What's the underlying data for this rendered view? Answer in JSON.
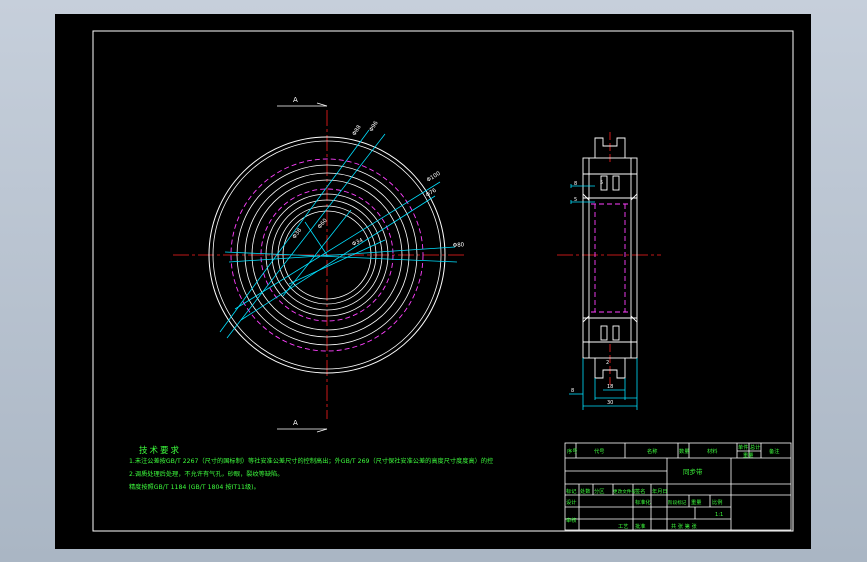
{
  "drawing": {
    "section_label": "A",
    "front_view": {
      "dimensions": [
        "Φ88",
        "Φ96",
        "Φ100",
        "Φ76",
        "Φ80",
        "Φ60",
        "Φ38",
        "Φ34"
      ]
    },
    "side_view": {
      "dimensions": [
        "8",
        "5",
        "5",
        "18",
        "2",
        "30",
        "8"
      ]
    }
  },
  "tech_requirements": {
    "title": "技术要求",
    "lines": [
      "1.未注公差按GB/T 2267（尺寸的国标制）等社安准公差尺寸的控制高出；外GB/T 269（尺寸保社安准公差的高度尺寸度度高）的控",
      "2.调质处理后处理，不允许有气孔，砂眼，裂纹等缺陷。",
      "  精度按照GB/T 1184 (GB/T 1804 按IT11级)。"
    ]
  },
  "title_block": {
    "part_name": "同步带",
    "headers": [
      "序号",
      "代号",
      "名称",
      "数量",
      "材料",
      "单件",
      "总计",
      "备注"
    ],
    "weight_label": "重量",
    "row_labels": [
      "标记",
      "处数",
      "分区",
      "更改文件号",
      "签名",
      "年月日"
    ],
    "sign_labels": [
      "设计",
      "标准化",
      "阶段标记",
      "重量",
      "比例"
    ],
    "check_labels": [
      "审核",
      "工艺",
      "批准"
    ],
    "sheet_info": "共 张 第 张",
    "scale": "1:1"
  },
  "colors": {
    "background": "#000000",
    "outline": "#ffffff",
    "centerline": "#ff2020",
    "dimension": "#00e0ff",
    "hidden": "#ff40ff",
    "text": "#3dfc3d",
    "table": "#ffffff"
  }
}
